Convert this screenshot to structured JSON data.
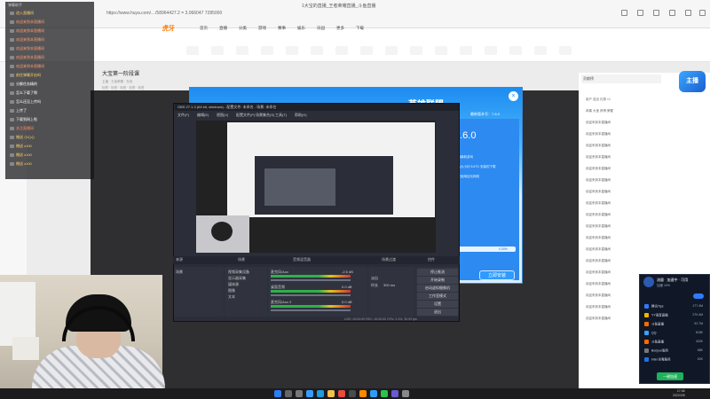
{
  "browser": {
    "address": "https://www.huya.com/…/58964427.2 = 3.066047 7285000",
    "window_title": "1大宝的直播_王者荣耀直播_斗鱼直播",
    "logo": "虎牙",
    "nav": [
      "首页",
      "直播",
      "分类",
      "游戏",
      "赛事",
      "娱乐",
      "乐园",
      "更多",
      "下载"
    ],
    "categories": [
      "",
      "",
      "",
      "",
      "",
      "",
      "",
      "",
      "",
      "",
      "",
      "",
      "",
      "",
      "",
      ""
    ]
  },
  "room": {
    "title": "大宝第一阶段课",
    "sub": "主播 · 王者荣耀 · 在线",
    "tags": "标签 · 标签 · 标签 · 标签 · 标签"
  },
  "overlay": {
    "title": "弹幕助手",
    "messages": [
      {
        "text": "进入直播间",
        "color": "#ffd36b"
      },
      {
        "text": "欢迎来到本直播间",
        "color": "#ff9c6b"
      },
      {
        "text": "欢迎来到本直播间",
        "color": "#ff9c6b"
      },
      {
        "text": "欢迎来到本直播间",
        "color": "#ff9c6b"
      },
      {
        "text": "欢迎来到本直播间",
        "color": "#ff9c6b"
      },
      {
        "text": "欢迎来到本直播间",
        "color": "#ff9c6b"
      },
      {
        "text": "欢迎来到本直播间",
        "color": "#ff9c6b"
      },
      {
        "text": "前往弹幕开启吗",
        "color": "#ffd36b"
      },
      {
        "text": "分解任务精的",
        "color": "#ffffff"
      },
      {
        "text": "怎么下载了啊",
        "color": "#ffffff"
      },
      {
        "text": "怎么还没上传吗",
        "color": "#ffffff"
      },
      {
        "text": "上传了",
        "color": "#ffffff"
      },
      {
        "text": "下载到网上啦",
        "color": "#ffffff"
      },
      {
        "text": "关注直播间",
        "color": "#ff8a5c"
      },
      {
        "text": "赠送 小心心",
        "color": "#ffd36b"
      },
      {
        "text": "赠送 x100",
        "color": "#ffd36b"
      },
      {
        "text": "赠送 x100",
        "color": "#ffd36b"
      },
      {
        "text": "赠送 x100",
        "color": "#ffd36b"
      }
    ]
  },
  "installer": {
    "title": "英雄联盟",
    "subtitle": "最新版本",
    "version_label": "最新版本号：7.6.0",
    "big_version": "7.6.0",
    "lines": [
      "支持最新游戏",
      "安装大小约 5.67G 安装的下载",
      "建议使用百兆网络"
    ],
    "progress_pct": "0.00%",
    "progress_value": 0,
    "start_button": "立即安装",
    "close": "×"
  },
  "obs": {
    "title": "OBS 27.1.3 (64 bit, windows) - 配置文件: 未命名 - 场景: 未命名",
    "menu": [
      "文件(F)",
      "编辑(E)",
      "视图(V)",
      "配置文件(P)",
      "场景集合(S)",
      "工具(T)",
      "帮助(H)"
    ],
    "docks": [
      "来源",
      "场景",
      "音频混音器",
      "场景过渡",
      "控件"
    ],
    "scene_items": [
      "场景"
    ],
    "source_items": [
      "视频采集设备",
      "显示器采集",
      "媒体源",
      "图像",
      "文本"
    ],
    "mixer": [
      {
        "name": "麦克风/Aux",
        "db": "-2.5 dB"
      },
      {
        "name": "桌面音频",
        "db": "0.0 dB"
      },
      {
        "name": "麦克风/Aux 2",
        "db": "0.0 dB"
      }
    ],
    "transition": {
      "type": "淡出",
      "duration_label": "时长",
      "duration": "300 ms"
    },
    "controls": [
      "停止推流",
      "开始录制",
      "启动虚拟摄像机",
      "工作室模式",
      "设置",
      "退出"
    ],
    "status": "LIVE: 00:00:00   REC: 00:00:00   CPU: 2.4%, 30.00 fps"
  },
  "chat": {
    "header": "贡献榜",
    "mascot": "主播",
    "lines": [
      "用户 送出 礼物 ×1",
      "恭喜 大宝 获得 荣耀",
      "欢迎来到本直播间",
      "欢迎来到本直播间",
      "欢迎来到本直播间",
      "欢迎来到本直播间",
      "欢迎来到本直播间",
      "欢迎来到本直播间",
      "欢迎来到本直播间",
      "欢迎来到本直播间",
      "欢迎来到本直播间",
      "欢迎来到本直播间",
      "欢迎来到本直播间",
      "欢迎来到本直播间",
      "欢迎来到本直播间",
      "欢迎来到本直播间",
      "欢迎来到本直播间",
      "欢迎来到本直播间",
      "欢迎来到本直播间",
      "欢迎来到本直播间"
    ]
  },
  "traffic": {
    "title": "流量 · 加速中 · 可用",
    "subtitle": "加速 10%",
    "rows": [
      {
        "name": "腾讯Tips",
        "value": "177.4M",
        "color": "#2e7bff"
      },
      {
        "name": "YY语音直播",
        "value": "270.4M",
        "color": "#f5b400"
      },
      {
        "name": "斗鱼直播",
        "value": "92.7M",
        "color": "#ff6a00"
      },
      {
        "name": "QQ",
        "value": "618K",
        "color": "#35a2ff"
      },
      {
        "name": "斗鱼直播",
        "value": "432K",
        "color": "#ff6a00"
      },
      {
        "name": "Bonjour服务",
        "value": "68K",
        "color": "#777777"
      },
      {
        "name": "Intel 杀毒服务",
        "value": "52K",
        "color": "#1a73e8"
      }
    ],
    "button": "一键加速"
  },
  "taskbar": {
    "icons": [
      "start",
      "search",
      "task-view",
      "widgets",
      "edge",
      "explorer",
      "chrome",
      "obs",
      "huya",
      "qq",
      "wechat",
      "store",
      "settings"
    ],
    "time": "17:46",
    "date": "2022/2/8"
  }
}
